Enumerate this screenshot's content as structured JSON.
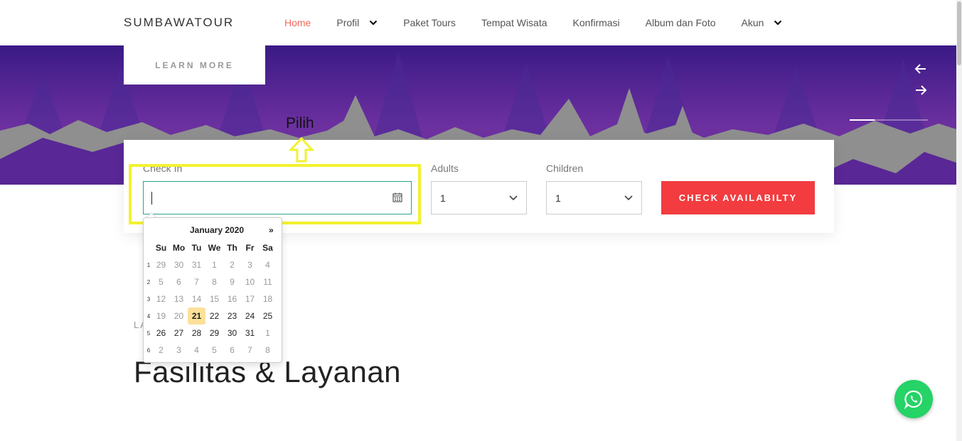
{
  "header": {
    "brand": "SUMBAWATOUR",
    "nav": [
      {
        "label": "Home",
        "active": true,
        "dropdown": false
      },
      {
        "label": "Profil",
        "active": false,
        "dropdown": true
      },
      {
        "label": "Paket Tours",
        "active": false,
        "dropdown": false
      },
      {
        "label": "Tempat Wisata",
        "active": false,
        "dropdown": false
      },
      {
        "label": "Konfirmasi",
        "active": false,
        "dropdown": false
      },
      {
        "label": "Album dan Foto",
        "active": false,
        "dropdown": false
      },
      {
        "label": "Akun",
        "active": false,
        "dropdown": true
      }
    ],
    "active_color": "#f06a5b"
  },
  "hero": {
    "learn_more": "LEARN MORE",
    "prev_icon": "arrow-left-icon",
    "next_icon": "arrow-right-icon"
  },
  "annotation": {
    "label": "Pilih",
    "color": "#f2f230"
  },
  "booking": {
    "checkin_label": "Check In",
    "checkin_value": "",
    "adults_label": "Adults",
    "adults_value": "1",
    "children_label": "Children",
    "children_value": "1",
    "button_label": "CHECK AVAILABILTY",
    "button_color": "#f23c3f"
  },
  "datepicker": {
    "month_title": "January 2020",
    "next_symbol": "»",
    "weekdays": [
      "Su",
      "Mo",
      "Tu",
      "We",
      "Th",
      "Fr",
      "Sa"
    ],
    "weeks": [
      {
        "num": "1",
        "days": [
          [
            "29",
            "old"
          ],
          [
            "30",
            "old"
          ],
          [
            "31",
            "old"
          ],
          [
            "1",
            "old"
          ],
          [
            "2",
            "old"
          ],
          [
            "3",
            "old"
          ],
          [
            "4",
            "old"
          ]
        ]
      },
      {
        "num": "2",
        "days": [
          [
            "5",
            "old"
          ],
          [
            "6",
            "old"
          ],
          [
            "7",
            "old"
          ],
          [
            "8",
            "old"
          ],
          [
            "9",
            "old"
          ],
          [
            "10",
            "old"
          ],
          [
            "11",
            "old"
          ]
        ]
      },
      {
        "num": "3",
        "days": [
          [
            "12",
            "old"
          ],
          [
            "13",
            "old"
          ],
          [
            "14",
            "old"
          ],
          [
            "15",
            "old"
          ],
          [
            "16",
            "old"
          ],
          [
            "17",
            "old"
          ],
          [
            "18",
            "old"
          ]
        ]
      },
      {
        "num": "4",
        "days": [
          [
            "19",
            "old"
          ],
          [
            "20",
            "old"
          ],
          [
            "21",
            "today"
          ],
          [
            "22",
            ""
          ],
          [
            "23",
            ""
          ],
          [
            "24",
            ""
          ],
          [
            "25",
            ""
          ]
        ]
      },
      {
        "num": "5",
        "days": [
          [
            "26",
            ""
          ],
          [
            "27",
            ""
          ],
          [
            "28",
            ""
          ],
          [
            "29",
            ""
          ],
          [
            "30",
            ""
          ],
          [
            "31",
            ""
          ],
          [
            "1",
            "old"
          ]
        ]
      },
      {
        "num": "6",
        "days": [
          [
            "2",
            "old"
          ],
          [
            "3",
            "old"
          ],
          [
            "4",
            "old"
          ],
          [
            "5",
            "old"
          ],
          [
            "6",
            "old"
          ],
          [
            "7",
            "old"
          ],
          [
            "8",
            "old"
          ]
        ]
      }
    ],
    "today_color": "#fde19a"
  },
  "section": {
    "small_label": "LA",
    "title": "Fasilitas & Layanan"
  },
  "whatsapp": {
    "icon": "whatsapp-icon",
    "color": "#25d366"
  }
}
